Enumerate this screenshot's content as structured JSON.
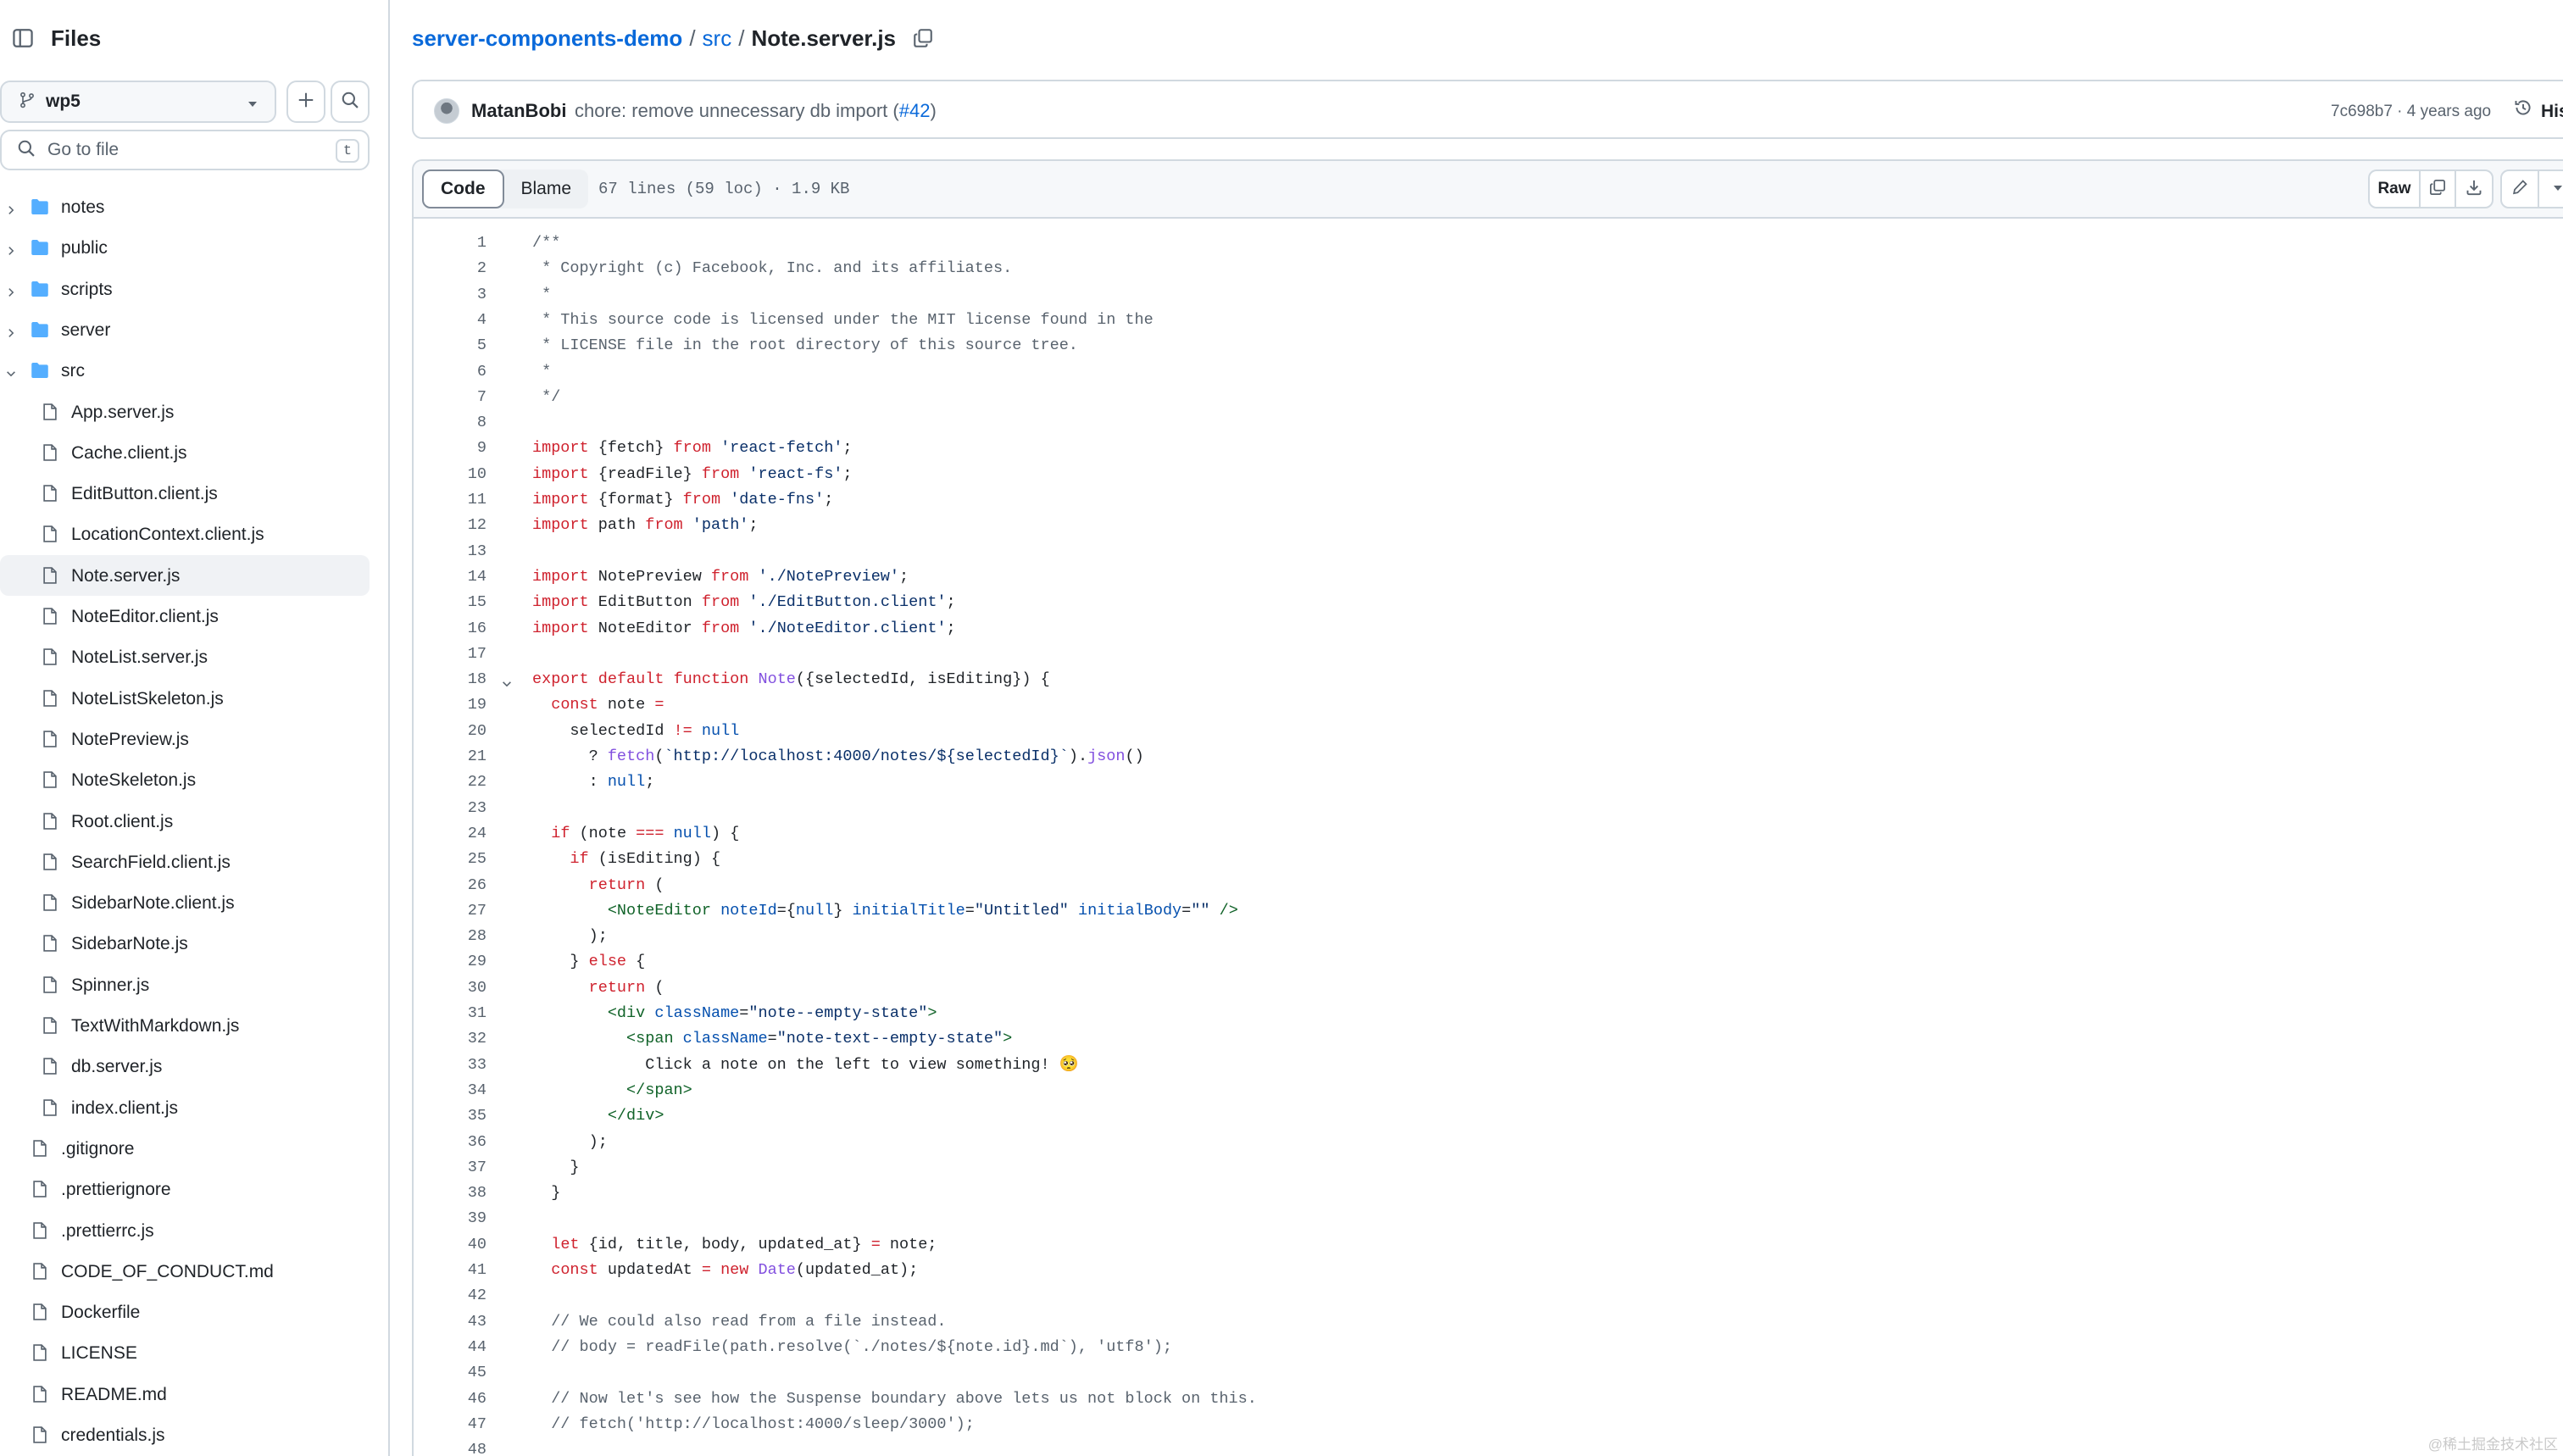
{
  "sidebar": {
    "title": "Files",
    "branch": "wp5",
    "goto_placeholder": "Go to file",
    "goto_shortcut": "t",
    "items": [
      {
        "label": "notes",
        "type": "folder",
        "expanded": false,
        "depth": 0
      },
      {
        "label": "public",
        "type": "folder",
        "expanded": false,
        "depth": 0
      },
      {
        "label": "scripts",
        "type": "folder",
        "expanded": false,
        "depth": 0
      },
      {
        "label": "server",
        "type": "folder",
        "expanded": false,
        "depth": 0
      },
      {
        "label": "src",
        "type": "folder",
        "expanded": true,
        "depth": 0
      },
      {
        "label": "App.server.js",
        "type": "file",
        "depth": 1
      },
      {
        "label": "Cache.client.js",
        "type": "file",
        "depth": 1
      },
      {
        "label": "EditButton.client.js",
        "type": "file",
        "depth": 1
      },
      {
        "label": "LocationContext.client.js",
        "type": "file",
        "depth": 1
      },
      {
        "label": "Note.server.js",
        "type": "file",
        "depth": 1,
        "selected": true
      },
      {
        "label": "NoteEditor.client.js",
        "type": "file",
        "depth": 1
      },
      {
        "label": "NoteList.server.js",
        "type": "file",
        "depth": 1
      },
      {
        "label": "NoteListSkeleton.js",
        "type": "file",
        "depth": 1
      },
      {
        "label": "NotePreview.js",
        "type": "file",
        "depth": 1
      },
      {
        "label": "NoteSkeleton.js",
        "type": "file",
        "depth": 1
      },
      {
        "label": "Root.client.js",
        "type": "file",
        "depth": 1
      },
      {
        "label": "SearchField.client.js",
        "type": "file",
        "depth": 1
      },
      {
        "label": "SidebarNote.client.js",
        "type": "file",
        "depth": 1
      },
      {
        "label": "SidebarNote.js",
        "type": "file",
        "depth": 1
      },
      {
        "label": "Spinner.js",
        "type": "file",
        "depth": 1
      },
      {
        "label": "TextWithMarkdown.js",
        "type": "file",
        "depth": 1
      },
      {
        "label": "db.server.js",
        "type": "file",
        "depth": 1
      },
      {
        "label": "index.client.js",
        "type": "file",
        "depth": 1
      },
      {
        "label": ".gitignore",
        "type": "file",
        "depth": 0
      },
      {
        "label": ".prettierignore",
        "type": "file",
        "depth": 0
      },
      {
        "label": ".prettierrc.js",
        "type": "file",
        "depth": 0
      },
      {
        "label": "CODE_OF_CONDUCT.md",
        "type": "file",
        "depth": 0
      },
      {
        "label": "Dockerfile",
        "type": "file",
        "depth": 0
      },
      {
        "label": "LICENSE",
        "type": "file",
        "depth": 0
      },
      {
        "label": "README.md",
        "type": "file",
        "depth": 0
      },
      {
        "label": "credentials.js",
        "type": "file",
        "depth": 0
      }
    ]
  },
  "breadcrumb": {
    "repo": "server-components-demo",
    "dir": "src",
    "file": "Note.server.js",
    "sep": "/"
  },
  "commit": {
    "author": "MatanBobi",
    "message": "chore: remove unnecessary db import (",
    "pr": "#42",
    "message_end": ")",
    "meta": "7c698b7 · 4 years ago",
    "history_label": "His"
  },
  "toolbar": {
    "code_tab": "Code",
    "blame_tab": "Blame",
    "file_info": "67 lines (59 loc) · 1.9 KB",
    "raw_label": "Raw"
  },
  "code": [
    [
      [
        "c",
        "/**"
      ]
    ],
    [
      [
        "c",
        " * Copyright (c) Facebook, Inc. and its affiliates."
      ]
    ],
    [
      [
        "c",
        " *"
      ]
    ],
    [
      [
        "c",
        " * This source code is licensed under the MIT license found in the"
      ]
    ],
    [
      [
        "c",
        " * LICENSE file in the root directory of this source tree."
      ]
    ],
    [
      [
        "c",
        " *"
      ]
    ],
    [
      [
        "c",
        " */"
      ]
    ],
    [],
    [
      [
        "k",
        "import"
      ],
      [
        "",
        " {fetch} "
      ],
      [
        "k",
        "from"
      ],
      [
        "",
        " "
      ],
      [
        "s",
        "'react-fetch'"
      ],
      [
        "",
        ";"
      ]
    ],
    [
      [
        "k",
        "import"
      ],
      [
        "",
        " {readFile} "
      ],
      [
        "k",
        "from"
      ],
      [
        "",
        " "
      ],
      [
        "s",
        "'react-fs'"
      ],
      [
        "",
        ";"
      ]
    ],
    [
      [
        "k",
        "import"
      ],
      [
        "",
        " {format} "
      ],
      [
        "k",
        "from"
      ],
      [
        "",
        " "
      ],
      [
        "s",
        "'date-fns'"
      ],
      [
        "",
        ";"
      ]
    ],
    [
      [
        "k",
        "import"
      ],
      [
        "",
        " path "
      ],
      [
        "k",
        "from"
      ],
      [
        "",
        " "
      ],
      [
        "s",
        "'path'"
      ],
      [
        "",
        ";"
      ]
    ],
    [],
    [
      [
        "k",
        "import"
      ],
      [
        "",
        " NotePreview "
      ],
      [
        "k",
        "from"
      ],
      [
        "",
        " "
      ],
      [
        "s",
        "'./NotePreview'"
      ],
      [
        "",
        ";"
      ]
    ],
    [
      [
        "k",
        "import"
      ],
      [
        "",
        " EditButton "
      ],
      [
        "k",
        "from"
      ],
      [
        "",
        " "
      ],
      [
        "s",
        "'./EditButton.client'"
      ],
      [
        "",
        ";"
      ]
    ],
    [
      [
        "k",
        "import"
      ],
      [
        "",
        " NoteEditor "
      ],
      [
        "k",
        "from"
      ],
      [
        "",
        " "
      ],
      [
        "s",
        "'./NoteEditor.client'"
      ],
      [
        "",
        ";"
      ]
    ],
    [],
    [
      [
        "k",
        "export"
      ],
      [
        "",
        " "
      ],
      [
        "k",
        "default"
      ],
      [
        "",
        " "
      ],
      [
        "k",
        "function"
      ],
      [
        "",
        " "
      ],
      [
        "f",
        "Note"
      ],
      [
        "",
        "({selectedId, isEditing}) {"
      ]
    ],
    [
      [
        "",
        "  "
      ],
      [
        "k",
        "const"
      ],
      [
        "",
        " note "
      ],
      [
        "k",
        "="
      ]
    ],
    [
      [
        "",
        "    selectedId "
      ],
      [
        "k",
        "!="
      ],
      [
        "",
        " "
      ],
      [
        "a",
        "null"
      ]
    ],
    [
      [
        "",
        "      ? "
      ],
      [
        "f",
        "fetch"
      ],
      [
        "",
        "("
      ],
      [
        "s",
        "`http://localhost:4000/notes/${selectedId}`"
      ],
      [
        "",
        ")."
      ],
      [
        "f",
        "json"
      ],
      [
        "",
        "()"
      ]
    ],
    [
      [
        "",
        "      : "
      ],
      [
        "a",
        "null"
      ],
      [
        "",
        ";"
      ]
    ],
    [],
    [
      [
        "",
        "  "
      ],
      [
        "k",
        "if"
      ],
      [
        "",
        " (note "
      ],
      [
        "k",
        "==="
      ],
      [
        "",
        " "
      ],
      [
        "a",
        "null"
      ],
      [
        "",
        ") {"
      ]
    ],
    [
      [
        "",
        "    "
      ],
      [
        "k",
        "if"
      ],
      [
        "",
        " (isEditing) {"
      ]
    ],
    [
      [
        "",
        "      "
      ],
      [
        "k",
        "return"
      ],
      [
        "",
        " ("
      ]
    ],
    [
      [
        "",
        "        "
      ],
      [
        "t",
        "<NoteEditor"
      ],
      [
        "",
        " "
      ],
      [
        "a",
        "noteId"
      ],
      [
        "",
        "={"
      ],
      [
        "a",
        "null"
      ],
      [
        "",
        "} "
      ],
      [
        "a",
        "initialTitle"
      ],
      [
        "",
        "="
      ],
      [
        "s",
        "\"Untitled\""
      ],
      [
        "",
        " "
      ],
      [
        "a",
        "initialBody"
      ],
      [
        "",
        "="
      ],
      [
        "s",
        "\"\""
      ],
      [
        "",
        " "
      ],
      [
        "t",
        "/>"
      ]
    ],
    [
      [
        "",
        "      );"
      ]
    ],
    [
      [
        "",
        "    } "
      ],
      [
        "k",
        "else"
      ],
      [
        "",
        " {"
      ]
    ],
    [
      [
        "",
        "      "
      ],
      [
        "k",
        "return"
      ],
      [
        "",
        " ("
      ]
    ],
    [
      [
        "",
        "        "
      ],
      [
        "t",
        "<div"
      ],
      [
        "",
        " "
      ],
      [
        "a",
        "className"
      ],
      [
        "",
        "="
      ],
      [
        "s",
        "\"note--empty-state\""
      ],
      [
        "t",
        ">"
      ]
    ],
    [
      [
        "",
        "          "
      ],
      [
        "t",
        "<span"
      ],
      [
        "",
        " "
      ],
      [
        "a",
        "className"
      ],
      [
        "",
        "="
      ],
      [
        "s",
        "\"note-text--empty-state\""
      ],
      [
        "t",
        ">"
      ]
    ],
    [
      [
        "",
        "            Click a note on the left to view something! 🥺"
      ]
    ],
    [
      [
        "",
        "          "
      ],
      [
        "t",
        "</span>"
      ]
    ],
    [
      [
        "",
        "        "
      ],
      [
        "t",
        "</div>"
      ]
    ],
    [
      [
        "",
        "      );"
      ]
    ],
    [
      [
        "",
        "    }"
      ]
    ],
    [
      [
        "",
        "  }"
      ]
    ],
    [],
    [
      [
        "",
        "  "
      ],
      [
        "k",
        "let"
      ],
      [
        "",
        " {id, title, body, updated_at} "
      ],
      [
        "k",
        "="
      ],
      [
        "",
        " note;"
      ]
    ],
    [
      [
        "",
        "  "
      ],
      [
        "k",
        "const"
      ],
      [
        "",
        " updatedAt "
      ],
      [
        "k",
        "="
      ],
      [
        "",
        " "
      ],
      [
        "k",
        "new"
      ],
      [
        "",
        " "
      ],
      [
        "f",
        "Date"
      ],
      [
        "",
        "(updated_at);"
      ]
    ],
    [],
    [
      [
        "c",
        "  // We could also read from a file instead."
      ]
    ],
    [
      [
        "c",
        "  // body = readFile(path.resolve(`./notes/${note.id}.md`), 'utf8');"
      ]
    ],
    [],
    [
      [
        "c",
        "  // Now let's see how the Suspense boundary above lets us not block on this."
      ]
    ],
    [
      [
        "c",
        "  // fetch('http://localhost:4000/sleep/3000');"
      ]
    ],
    []
  ],
  "watermark": "@稀土掘金技术社区"
}
